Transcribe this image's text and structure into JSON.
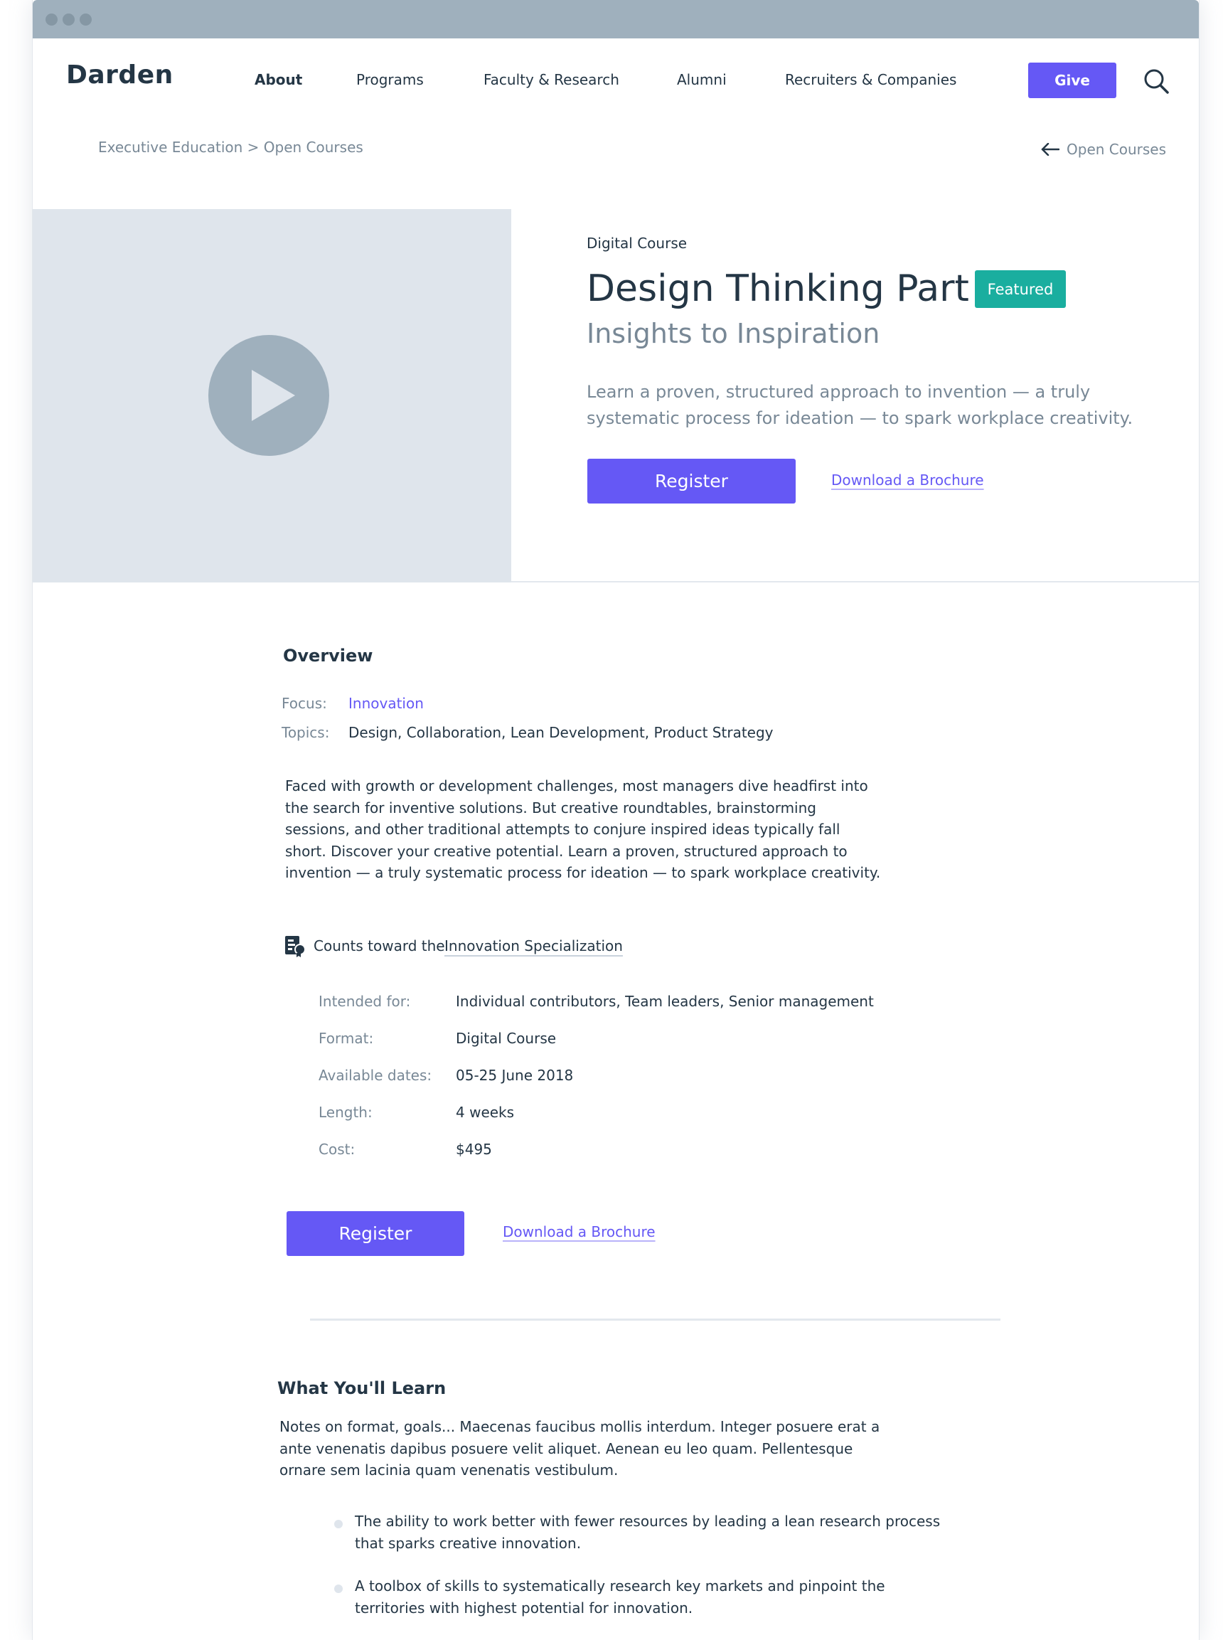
{
  "header": {
    "logo": "Darden",
    "nav": [
      "About",
      "Programs",
      "Faculty & Research",
      "Alumni",
      "Recruiters & Companies"
    ],
    "give_label": "Give"
  },
  "breadcrumb": "Executive Education > Open Courses",
  "back_link": "Open Courses",
  "hero": {
    "eyebrow": "Digital Course",
    "title": "Design Thinking Part I",
    "badge": "Featured",
    "subtitle": "Insights to Inspiration",
    "description": "Learn a proven, structured approach to invention — a truly systematic process for ideation — to spark workplace creativity.",
    "register_label": "Register",
    "brochure_label": "Download a Brochure"
  },
  "overview": {
    "heading": "Overview",
    "focus_label": "Focus:",
    "focus_value": "Innovation",
    "topics_label": "Topics:",
    "topics_value": "Design, Collaboration, Lean Development, Product Strategy",
    "body": "Faced with growth or development challenges, most managers dive headfirst into the search for inventive solutions. But creative roundtables, brainstorming sessions, and other traditional attempts to conjure inspired ideas typically fall short. Discover your creative potential. Learn a proven, structured approach to invention — a truly systematic process for ideation — to spark workplace creativity.",
    "counts_prefix": "Counts toward the",
    "counts_link": "Innovation Specialization",
    "specs": [
      {
        "label": "Intended for:",
        "value": "Individual contributors, Team leaders, Senior management"
      },
      {
        "label": "Format:",
        "value": "Digital Course"
      },
      {
        "label": "Available dates:",
        "value": "05-25 June 2018"
      },
      {
        "label": "Length:",
        "value": "4 weeks"
      },
      {
        "label": "Cost:",
        "value": "$495"
      }
    ],
    "register_label": "Register",
    "brochure_label": "Download a Brochure"
  },
  "learn": {
    "heading": "What You'll Learn",
    "intro": "Notes on format, goals... Maecenas faucibus mollis interdum. Integer posuere erat a ante venenatis dapibus posuere velit aliquet. Aenean eu leo quam. Pellentesque ornare sem lacinia quam venenatis vestibulum.",
    "bullets": [
      "The ability to work better with fewer resources by leading a lean research process that sparks creative innovation.",
      "A toolbox of skills to systematically research key markets and pinpoint the territories with highest potential for innovation."
    ]
  },
  "colors": {
    "accent": "#6558f5",
    "badge": "#1aae9f",
    "text": "#243645",
    "muted": "#788896",
    "media_bg": "#dfe5ec",
    "chrome": "#9fb0bd"
  },
  "icons": [
    "play-icon",
    "search-icon",
    "arrow-left-icon",
    "specialization-icon",
    "bullet-dot"
  ]
}
